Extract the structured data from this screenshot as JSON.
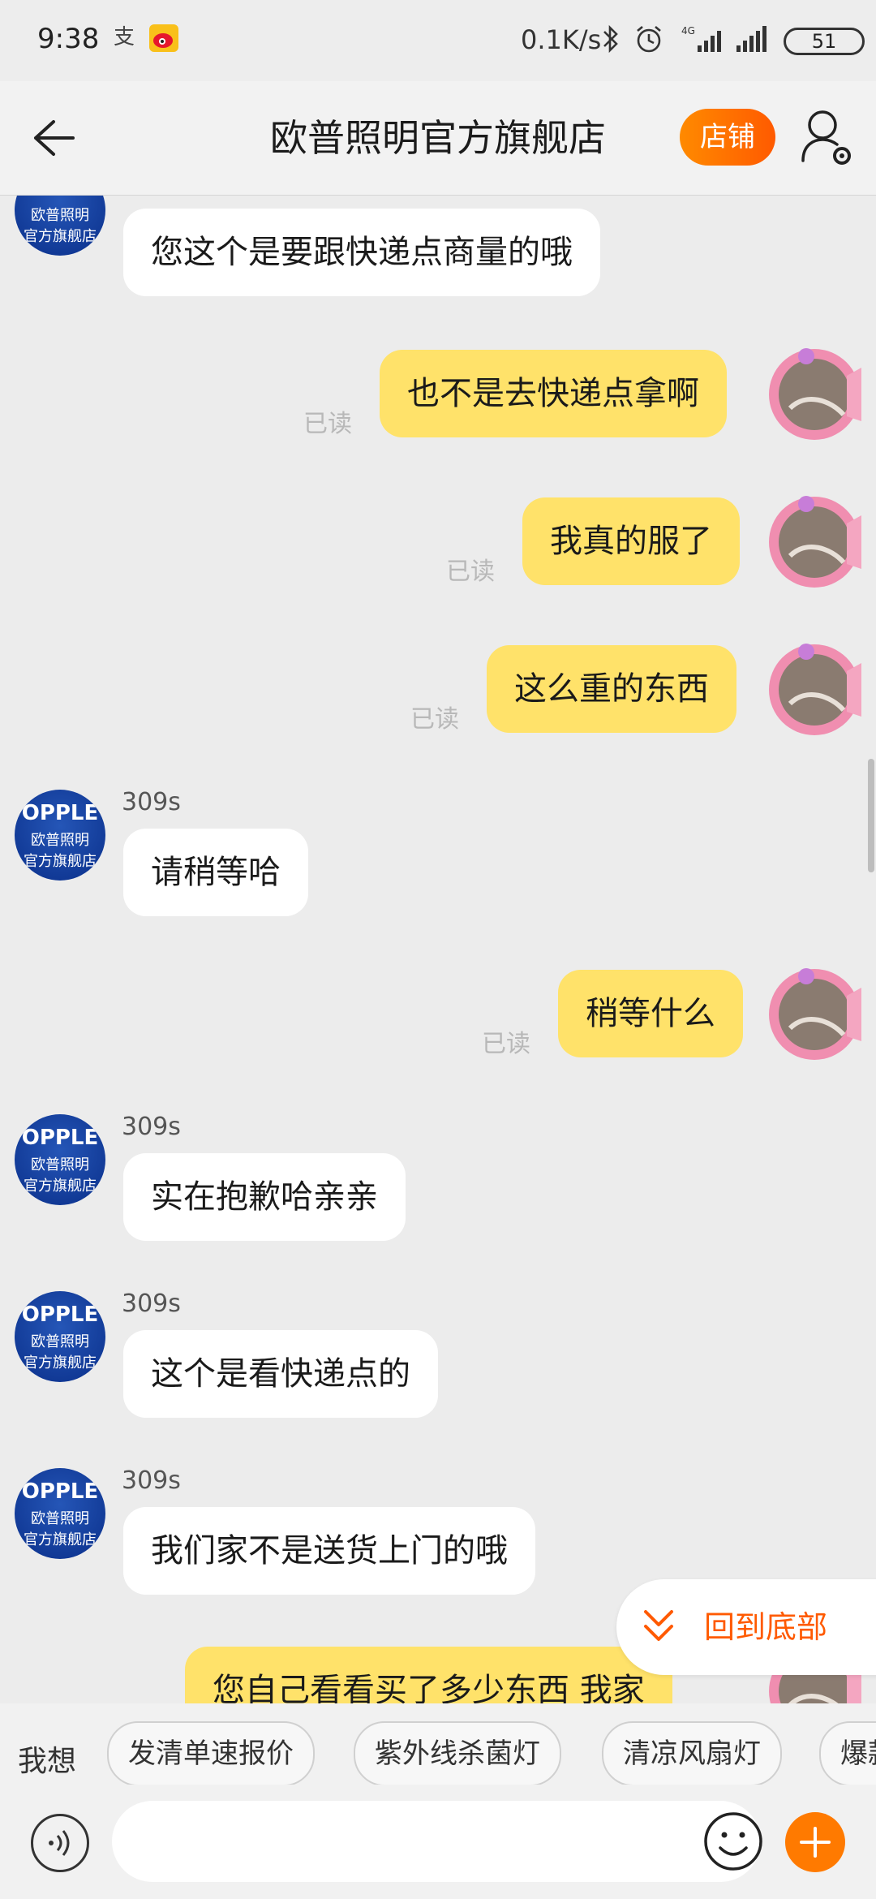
{
  "status_bar": {
    "time": "9:38",
    "network_speed": "0.1K/s",
    "network_type": "4G",
    "battery": "51",
    "icons": [
      "alipay-icon",
      "weibo-icon",
      "bluetooth-icon",
      "alarm-icon",
      "signal-icon",
      "signal-icon",
      "battery-icon"
    ]
  },
  "header": {
    "title": "欧普照明官方旗舰店",
    "store_button": "店铺",
    "back_icon": "back-arrow-icon",
    "settings_icon": "user-settings-icon"
  },
  "shop_avatar": {
    "brand": "OPPLE",
    "line1": "欧普照明",
    "line2": "官方旗舰店"
  },
  "messages": [
    {
      "from": "shop",
      "nick": "",
      "text": "您这个是要跟快递点商量的哦"
    },
    {
      "from": "me",
      "status": "已读",
      "text": "也不是去快递点拿啊"
    },
    {
      "from": "me",
      "status": "已读",
      "text": "我真的服了"
    },
    {
      "from": "me",
      "status": "已读",
      "text": "这么重的东西"
    },
    {
      "from": "shop",
      "nick": "309s",
      "text": "请稍等哈"
    },
    {
      "from": "me",
      "status": "已读",
      "text": "稍等什么"
    },
    {
      "from": "shop",
      "nick": "309s",
      "text": "实在抱歉哈亲亲"
    },
    {
      "from": "shop",
      "nick": "309s",
      "text": "这个是看快递点的"
    },
    {
      "from": "shop",
      "nick": "309s",
      "text": "我们家不是送货上门的哦"
    },
    {
      "from": "me",
      "status": "",
      "text": "您自己看看买了多少东西 我家"
    }
  ],
  "scroll_to_bottom": "回到底部",
  "quick_bar": {
    "label": "我想",
    "chips": [
      "发清单速报价",
      "紫外线杀菌灯",
      "清凉风扇灯",
      "爆款"
    ]
  },
  "input_bar": {
    "voice_icon": "voice-icon",
    "emoji_icon": "emoji-icon",
    "plus_icon": "plus-icon"
  },
  "colors": {
    "accent": "#ff6a00",
    "my_bubble": "#ffe26a",
    "their_bubble": "#ffffff",
    "background": "#ececec"
  }
}
